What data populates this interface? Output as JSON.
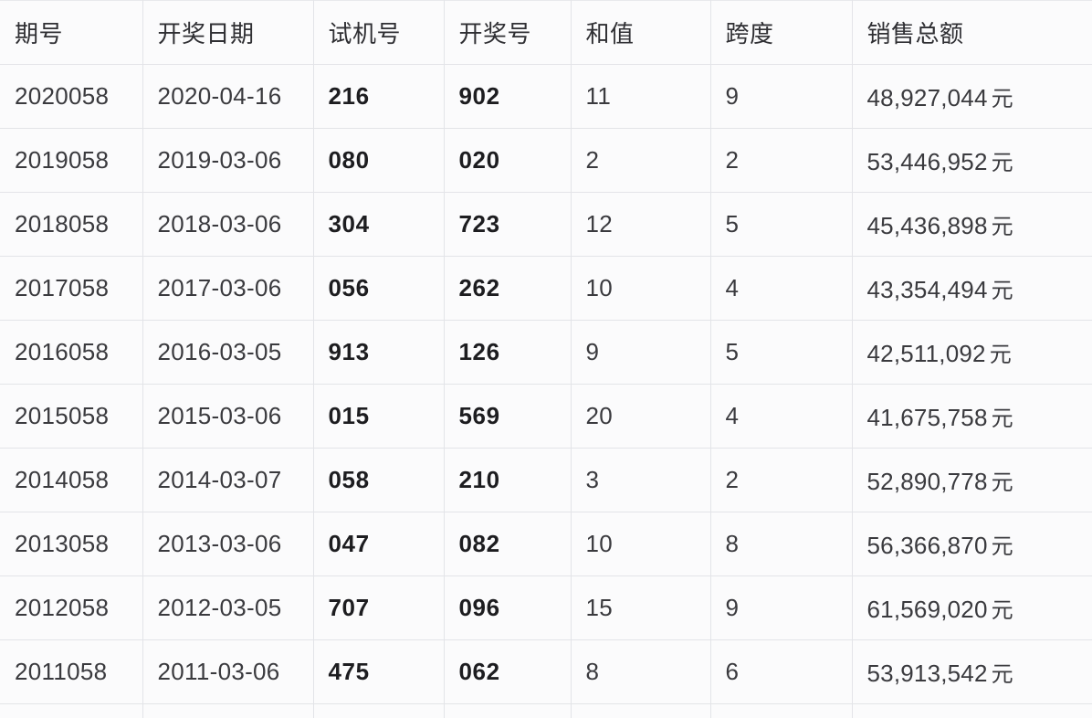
{
  "table": {
    "name": "lottery-results-table",
    "currency_suffix": "元",
    "columns": [
      {
        "key": "issue",
        "label": "期号",
        "bold": false
      },
      {
        "key": "date",
        "label": "开奖日期",
        "bold": false
      },
      {
        "key": "test",
        "label": "试机号",
        "bold": true
      },
      {
        "key": "draw",
        "label": "开奖号",
        "bold": true
      },
      {
        "key": "sum",
        "label": "和值",
        "bold": false
      },
      {
        "key": "span",
        "label": "跨度",
        "bold": false
      },
      {
        "key": "sales",
        "label": "销售总额",
        "bold": false
      }
    ],
    "rows": [
      {
        "issue": "2020058",
        "date": "2020-04-16",
        "test": "216",
        "draw": "902",
        "sum": "11",
        "span": "9",
        "sales": "48,927,044",
        "sales_unit": "元"
      },
      {
        "issue": "2019058",
        "date": "2019-03-06",
        "test": "080",
        "draw": "020",
        "sum": "2",
        "span": "2",
        "sales": "53,446,952",
        "sales_unit": "元"
      },
      {
        "issue": "2018058",
        "date": "2018-03-06",
        "test": "304",
        "draw": "723",
        "sum": "12",
        "span": "5",
        "sales": "45,436,898",
        "sales_unit": "元"
      },
      {
        "issue": "2017058",
        "date": "2017-03-06",
        "test": "056",
        "draw": "262",
        "sum": "10",
        "span": "4",
        "sales": "43,354,494",
        "sales_unit": "元"
      },
      {
        "issue": "2016058",
        "date": "2016-03-05",
        "test": "913",
        "draw": "126",
        "sum": "9",
        "span": "5",
        "sales": "42,511,092",
        "sales_unit": "元"
      },
      {
        "issue": "2015058",
        "date": "2015-03-06",
        "test": "015",
        "draw": "569",
        "sum": "20",
        "span": "4",
        "sales": "41,675,758",
        "sales_unit": "元"
      },
      {
        "issue": "2014058",
        "date": "2014-03-07",
        "test": "058",
        "draw": "210",
        "sum": "3",
        "span": "2",
        "sales": "52,890,778",
        "sales_unit": "元"
      },
      {
        "issue": "2013058",
        "date": "2013-03-06",
        "test": "047",
        "draw": "082",
        "sum": "10",
        "span": "8",
        "sales": "56,366,870",
        "sales_unit": "元"
      },
      {
        "issue": "2012058",
        "date": "2012-03-05",
        "test": "707",
        "draw": "096",
        "sum": "15",
        "span": "9",
        "sales": "61,569,020",
        "sales_unit": "元"
      },
      {
        "issue": "2011058",
        "date": "2011-03-06",
        "test": "475",
        "draw": "062",
        "sum": "8",
        "span": "6",
        "sales": "53,913,542",
        "sales_unit": "元"
      }
    ]
  },
  "colors": {
    "background": "#fbfbfc",
    "grid_line": "#e3e4e8",
    "header_text": "#2f2f33",
    "body_text": "#3a3a3e",
    "bold_text": "#1d1d20"
  }
}
